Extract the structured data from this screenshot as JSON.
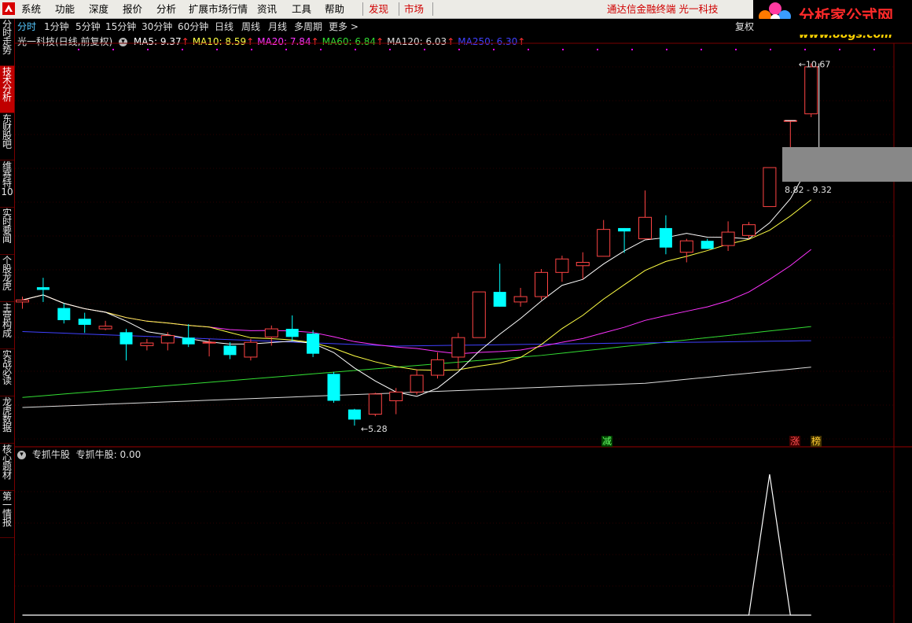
{
  "menu": {
    "items": [
      "系统",
      "功能",
      "深度",
      "报价",
      "分析",
      "扩展市场行情",
      "资讯",
      "工具",
      "帮助"
    ],
    "discover": "发现",
    "market": "市场",
    "title": "通达信金融终端  光一科技"
  },
  "logo": {
    "main": "分析家公式网",
    "url": "www.88gs.com"
  },
  "periods": [
    "分时",
    "1分钟",
    "5分钟",
    "15分钟",
    "30分钟",
    "60分钟",
    "日线",
    "周线",
    "月线",
    "多周期",
    "更多 >"
  ],
  "fuquan_button": "复权",
  "sidebar": {
    "tabs": [
      "分时走势",
      "技术分析",
      "东财股吧",
      "维赛特10",
      "实时要闻",
      "个股龙虎",
      "主营构成",
      "实战必读",
      "龙虎数据",
      "核心题材",
      "第一情报"
    ]
  },
  "main_legend": {
    "stock": "光一科技(日线,前复权)",
    "ma": [
      {
        "label": "MA5: 9.37",
        "color": "#ffffff"
      },
      {
        "label": "MA10: 8.59",
        "color": "#ffff44"
      },
      {
        "label": "MA20: 7.84",
        "color": "#ff33ff"
      },
      {
        "label": "MA60: 6.84",
        "color": "#33dd33"
      },
      {
        "label": "MA120: 6.03",
        "color": "#dddddd"
      },
      {
        "label": "MA250: 6.30",
        "color": "#4040ff"
      }
    ]
  },
  "annotations": {
    "high": "10.67",
    "low": "5.28",
    "range": "8.82 - 9.32",
    "markers": [
      "减",
      "涨",
      "榜"
    ]
  },
  "indicator": {
    "name": "专抓牛股",
    "value_label": "专抓牛股: 0.00"
  },
  "colors": {
    "up": "#ff4444",
    "down": "#00ffff",
    "accent": "#c00000"
  },
  "chart_data": {
    "type": "candlestick",
    "ylim": [
      5.0,
      10.9
    ],
    "candles": [
      {
        "o": 7.12,
        "c": 7.15,
        "h": 7.2,
        "l": 7.02
      },
      {
        "o": 7.34,
        "c": 7.3,
        "h": 7.48,
        "l": 7.12
      },
      {
        "o": 7.03,
        "c": 6.85,
        "h": 7.1,
        "l": 6.8
      },
      {
        "o": 6.87,
        "c": 6.78,
        "h": 6.96,
        "l": 6.66
      },
      {
        "o": 6.72,
        "c": 6.76,
        "h": 6.84,
        "l": 6.7
      },
      {
        "o": 6.67,
        "c": 6.49,
        "h": 6.72,
        "l": 6.25
      },
      {
        "o": 6.47,
        "c": 6.51,
        "h": 6.57,
        "l": 6.4
      },
      {
        "o": 6.51,
        "c": 6.62,
        "h": 6.67,
        "l": 6.4
      },
      {
        "o": 6.59,
        "c": 6.49,
        "h": 6.79,
        "l": 6.45
      },
      {
        "o": 6.51,
        "c": 6.52,
        "h": 6.57,
        "l": 6.31
      },
      {
        "o": 6.47,
        "c": 6.33,
        "h": 6.52,
        "l": 6.27
      },
      {
        "o": 6.3,
        "c": 6.52,
        "h": 6.57,
        "l": 6.25
      },
      {
        "o": 6.6,
        "c": 6.72,
        "h": 6.77,
        "l": 6.47
      },
      {
        "o": 6.72,
        "c": 6.6,
        "h": 6.92,
        "l": 6.54
      },
      {
        "o": 6.65,
        "c": 6.35,
        "h": 6.7,
        "l": 6.3
      },
      {
        "o": 6.05,
        "c": 5.65,
        "h": 6.08,
        "l": 5.62
      },
      {
        "o": 5.52,
        "c": 5.37,
        "h": 5.53,
        "l": 5.28
      },
      {
        "o": 5.45,
        "c": 5.75,
        "h": 5.77,
        "l": 5.42
      },
      {
        "o": 5.65,
        "c": 5.78,
        "h": 5.84,
        "l": 5.45
      },
      {
        "o": 5.78,
        "c": 6.03,
        "h": 6.12,
        "l": 5.74
      },
      {
        "o": 6.03,
        "c": 6.26,
        "h": 6.37,
        "l": 5.98
      },
      {
        "o": 6.3,
        "c": 6.59,
        "h": 6.66,
        "l": 6.13
      },
      {
        "o": 6.59,
        "c": 7.27,
        "h": 7.27,
        "l": 6.59
      },
      {
        "o": 7.27,
        "c": 7.05,
        "h": 7.69,
        "l": 7.05
      },
      {
        "o": 7.12,
        "c": 7.2,
        "h": 7.33,
        "l": 7.05
      },
      {
        "o": 7.2,
        "c": 7.56,
        "h": 7.61,
        "l": 7.15
      },
      {
        "o": 7.56,
        "c": 7.76,
        "h": 7.81,
        "l": 7.42
      },
      {
        "o": 7.66,
        "c": 7.71,
        "h": 7.86,
        "l": 7.46
      },
      {
        "o": 7.8,
        "c": 8.2,
        "h": 8.34,
        "l": 7.8
      },
      {
        "o": 8.22,
        "c": 8.17,
        "h": 8.22,
        "l": 7.85
      },
      {
        "o": 8.06,
        "c": 8.38,
        "h": 8.78,
        "l": 8.06
      },
      {
        "o": 8.22,
        "c": 7.93,
        "h": 8.41,
        "l": 7.83
      },
      {
        "o": 7.86,
        "c": 8.03,
        "h": 8.06,
        "l": 7.71
      },
      {
        "o": 8.03,
        "c": 7.91,
        "h": 8.06,
        "l": 7.91
      },
      {
        "o": 7.96,
        "c": 8.16,
        "h": 8.32,
        "l": 7.88
      },
      {
        "o": 8.11,
        "c": 8.27,
        "h": 8.31,
        "l": 8.06
      },
      {
        "o": 8.54,
        "c": 9.12,
        "h": 9.12,
        "l": 8.54
      },
      {
        "o": 9.82,
        "c": 9.82,
        "h": 9.82,
        "l": 9.42
      },
      {
        "o": 9.92,
        "c": 10.62,
        "h": 10.67,
        "l": 9.87
      }
    ],
    "indicator": {
      "values": [
        0,
        0,
        0,
        0,
        0,
        0,
        0,
        0,
        0,
        0,
        0,
        0,
        0,
        0,
        0,
        0,
        0,
        0,
        0,
        0,
        0,
        0,
        0,
        0,
        0,
        0,
        0,
        0,
        0,
        0,
        0,
        0,
        0,
        0,
        0,
        0,
        1,
        0,
        0
      ],
      "ylim": [
        0,
        1.1
      ]
    }
  }
}
